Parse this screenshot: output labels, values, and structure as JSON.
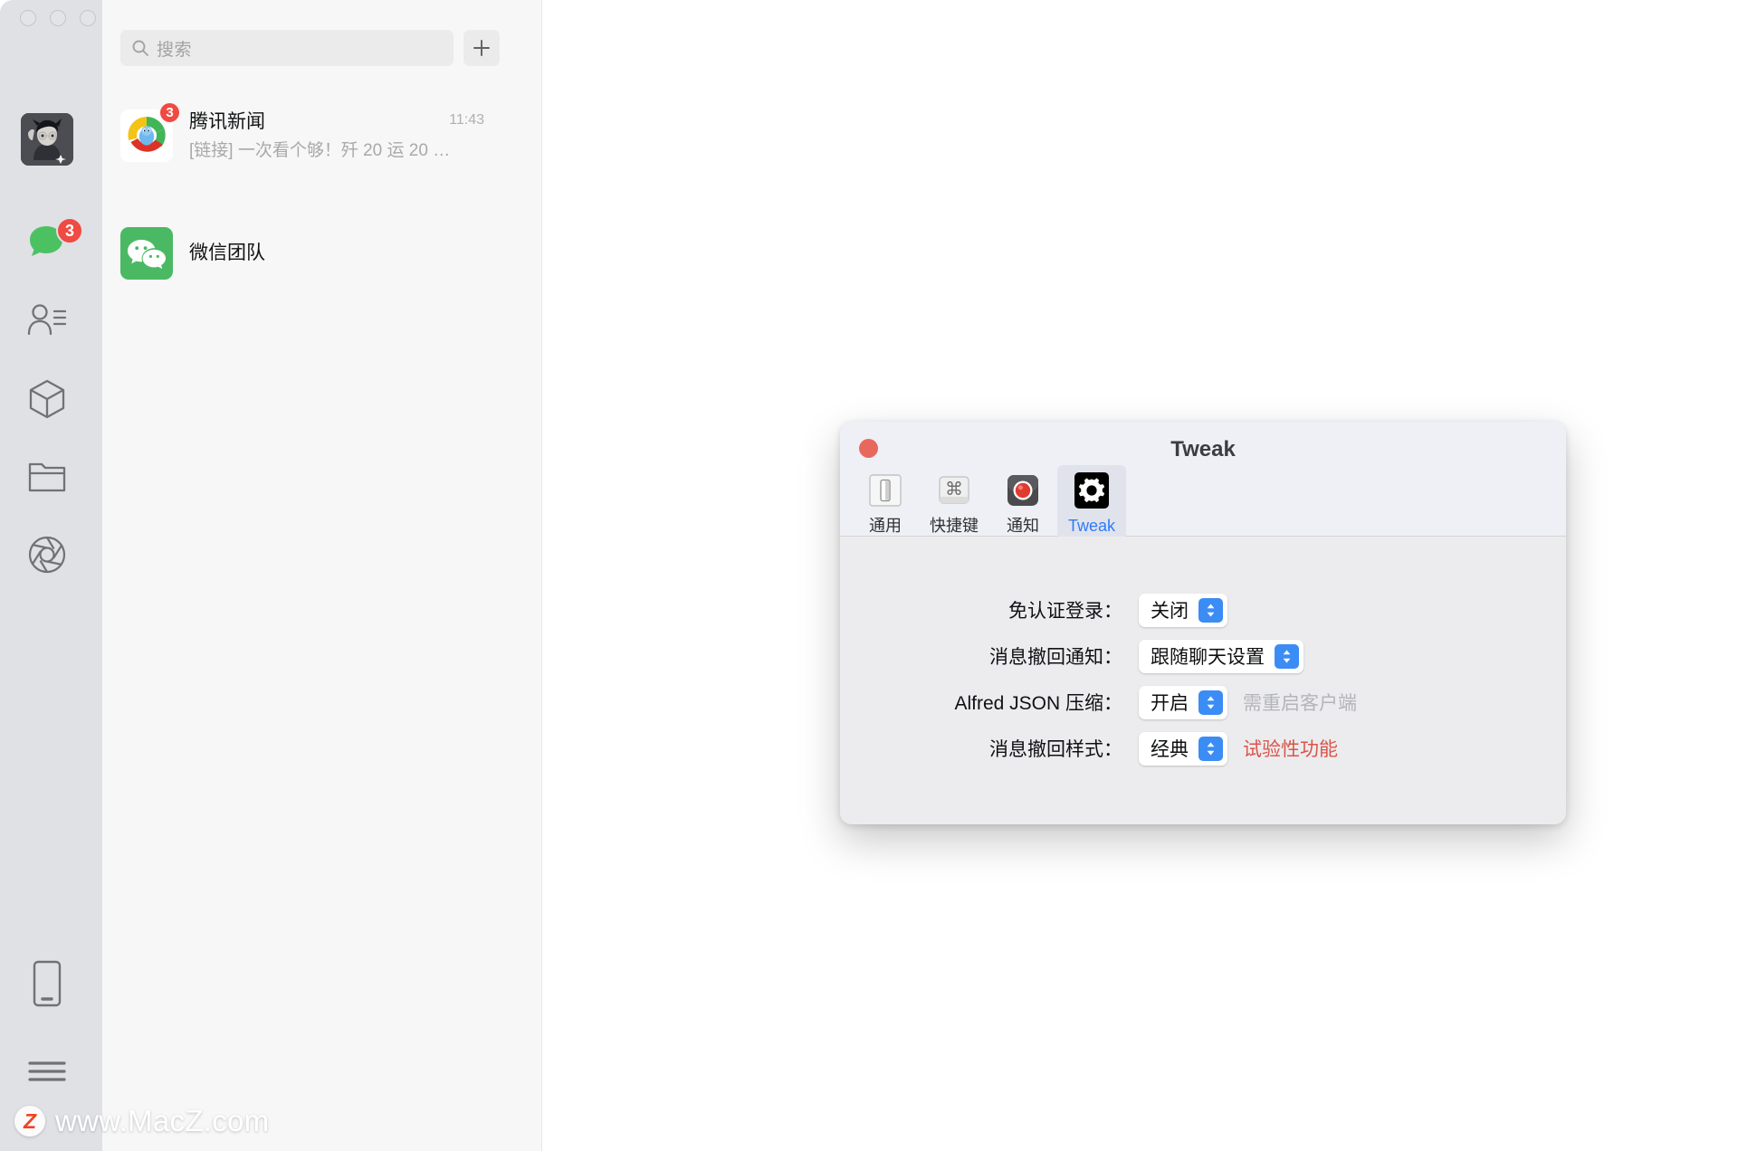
{
  "wechat": {
    "window_controls": [
      "close",
      "minimize",
      "zoom"
    ],
    "search": {
      "placeholder": "搜索",
      "icon": "search-icon",
      "value": ""
    },
    "add_button": {
      "label": "+",
      "icon": "plus-icon"
    },
    "rail": {
      "avatar": {
        "icon": "user-avatar"
      },
      "items": [
        {
          "icon": "chat-bubble-icon",
          "name": "chats",
          "badge": "3"
        },
        {
          "icon": "contacts-icon",
          "name": "contacts",
          "badge": ""
        },
        {
          "icon": "mini-program-box-icon",
          "name": "mini-programs",
          "badge": ""
        },
        {
          "icon": "folder-icon",
          "name": "favorites",
          "badge": ""
        },
        {
          "icon": "aperture-icon",
          "name": "moments",
          "badge": ""
        },
        {
          "icon": "phone-icon",
          "name": "phone",
          "badge": ""
        },
        {
          "icon": "hamburger-menu-icon",
          "name": "more",
          "badge": ""
        }
      ]
    },
    "chats": [
      {
        "name": "腾讯新闻",
        "snippet": "[链接] 一次看个够！歼 20 运 20 …",
        "time": "11:43",
        "unread": "3",
        "avatar": "tencent-news-logo"
      },
      {
        "name": "微信团队",
        "snippet": "",
        "time": "",
        "unread": "",
        "avatar": "wechat-logo"
      }
    ]
  },
  "watermark": {
    "logo_letter": "Z",
    "text": "www.MacZ.com"
  },
  "tweak": {
    "title": "Tweak",
    "close_button": "close",
    "toolbar": [
      {
        "label": "通用",
        "icon": "toggle-switch-icon",
        "selected": false
      },
      {
        "label": "快捷键",
        "icon": "command-key-icon",
        "selected": false
      },
      {
        "label": "通知",
        "icon": "record-dot-icon",
        "selected": false
      },
      {
        "label": "Tweak",
        "icon": "gear-icon",
        "selected": true
      }
    ],
    "rows": [
      {
        "label": "免认证登录：",
        "value": "关闭",
        "hint": "",
        "hint_kind": ""
      },
      {
        "label": "消息撤回通知：",
        "value": "跟随聊天设置",
        "hint": "",
        "hint_kind": ""
      },
      {
        "label": "Alfred JSON 压缩：",
        "value": "开启",
        "hint": "需重启客户端",
        "hint_kind": "gray"
      },
      {
        "label": "消息撤回样式：",
        "value": "经典",
        "hint": "试验性功能",
        "hint_kind": "red"
      }
    ],
    "colors": {
      "accent_blue": "#3b8cf6",
      "selected_tab_text": "#2f7bf6",
      "warning_red": "#d9544a",
      "hint_gray": "#b3b5ba"
    }
  }
}
